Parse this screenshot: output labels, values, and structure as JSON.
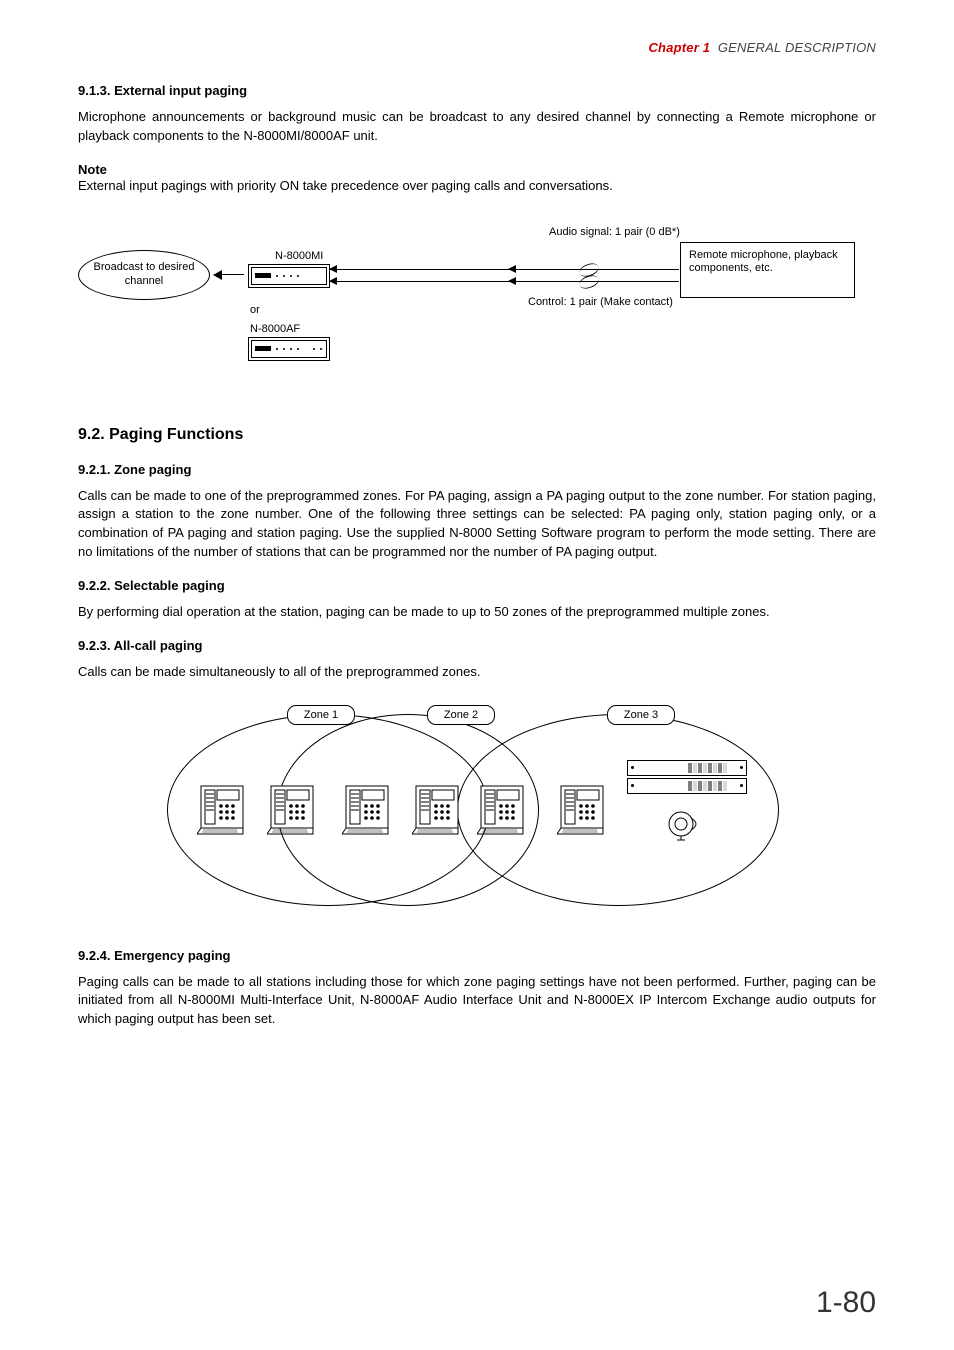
{
  "runningHead": {
    "chapter": "Chapter 1",
    "title": "GENERAL DESCRIPTION"
  },
  "sec913": {
    "heading": "9.1.3. External input paging",
    "body": "Microphone announcements or background music can be broadcast to any desired channel by connecting a Remote microphone or playback components to the N-8000MI/8000AF unit.",
    "noteLabel": "Note",
    "noteBody": "External input pagings with priority ON take precedence over paging calls and conversations."
  },
  "diagram1": {
    "broadcast": "Broadcast to desired channel",
    "labelMI": "N-8000MI",
    "or": "or",
    "labelAF": "N-8000AF",
    "audioSignal": "Audio signal: 1 pair (0 dB*)",
    "control": "Control: 1 pair (Make contact)",
    "remoteBox": "Remote microphone, playback components, etc."
  },
  "sec92": {
    "heading": "9.2. Paging Functions"
  },
  "sec921": {
    "heading": "9.2.1. Zone paging",
    "body": "Calls can be made to one of the preprogrammed zones. For PA paging, assign a PA paging output to the zone number. For station paging, assign a station to the zone number. One of the following three settings can be selected: PA paging only, station paging only, or a combination of PA paging and station paging. Use the supplied N-8000 Setting Software program to perform the mode setting. There are no limitations of the number of stations that can be programmed nor the number of PA paging output."
  },
  "sec922": {
    "heading": "9.2.2. Selectable paging",
    "body": "By performing dial operation at the station, paging can be made to up to 50 zones of the preprogrammed multiple zones."
  },
  "sec923": {
    "heading": "9.2.3. All-call paging",
    "body": "Calls can be made simultaneously to all of the preprogrammed zones."
  },
  "diagram2": {
    "zone1": "Zone 1",
    "zone2": "Zone 2",
    "zone3": "Zone 3"
  },
  "sec924": {
    "heading": "9.2.4. Emergency paging",
    "body": "Paging calls can be made to all stations including those for which zone paging settings have not been performed. Further, paging can be initiated from all N-8000MI Multi-Interface Unit, N-8000AF Audio Interface Unit and N-8000EX IP Intercom Exchange audio outputs for which paging output has been set."
  },
  "pageNumber": "1-80"
}
